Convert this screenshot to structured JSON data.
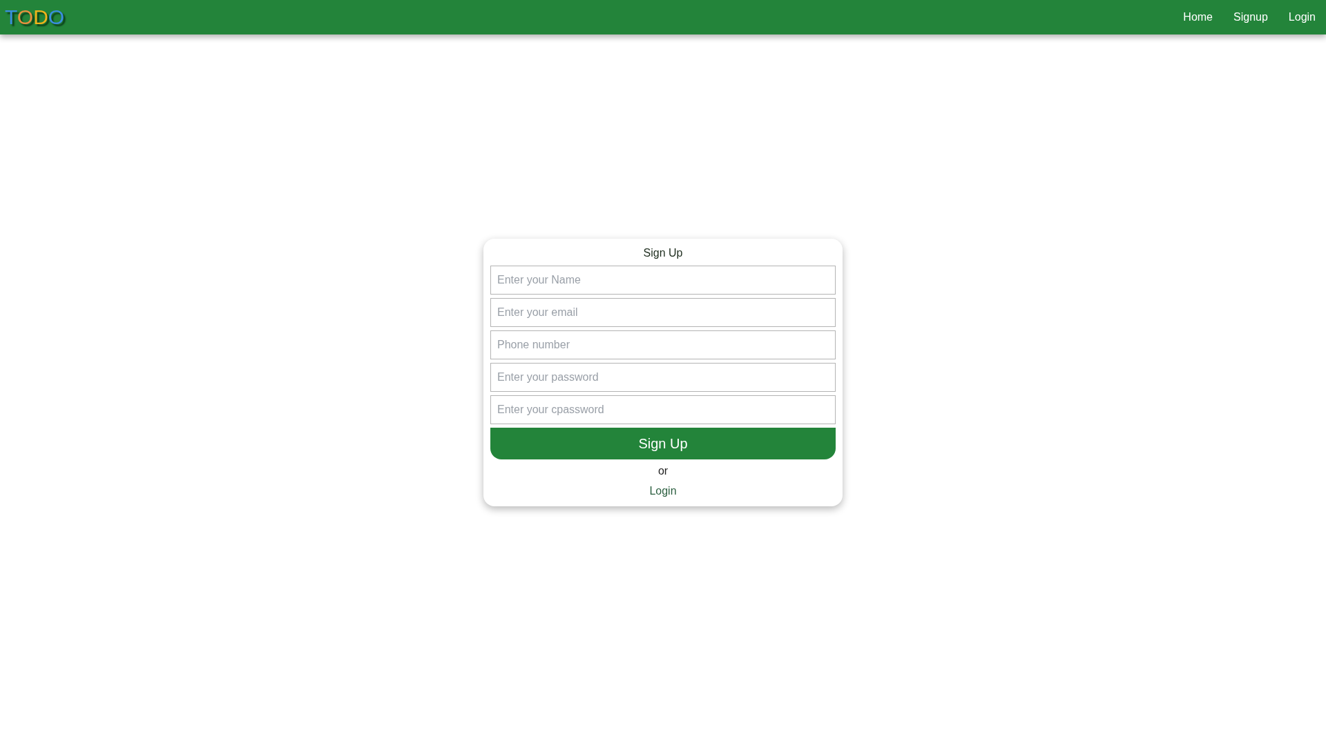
{
  "navbar": {
    "logo": {
      "letters": [
        {
          "text": "T",
          "color": "#3a8ee0"
        },
        {
          "text": "O",
          "color": "#e8913f"
        },
        {
          "text": "D",
          "color": "#f0b21a"
        },
        {
          "text": "O",
          "color": "#3a8ee0"
        }
      ]
    },
    "links": [
      {
        "label": "Home"
      },
      {
        "label": "Signup"
      },
      {
        "label": "Login"
      }
    ]
  },
  "form": {
    "title": "Sign Up",
    "fields": [
      {
        "placeholder": "Enter your Name"
      },
      {
        "placeholder": "Enter your email"
      },
      {
        "placeholder": "Phone number"
      },
      {
        "placeholder": "Enter your password"
      },
      {
        "placeholder": "Enter your cpassword"
      }
    ],
    "submit": "Sign Up",
    "separator": "or",
    "alt_link": "Login"
  }
}
